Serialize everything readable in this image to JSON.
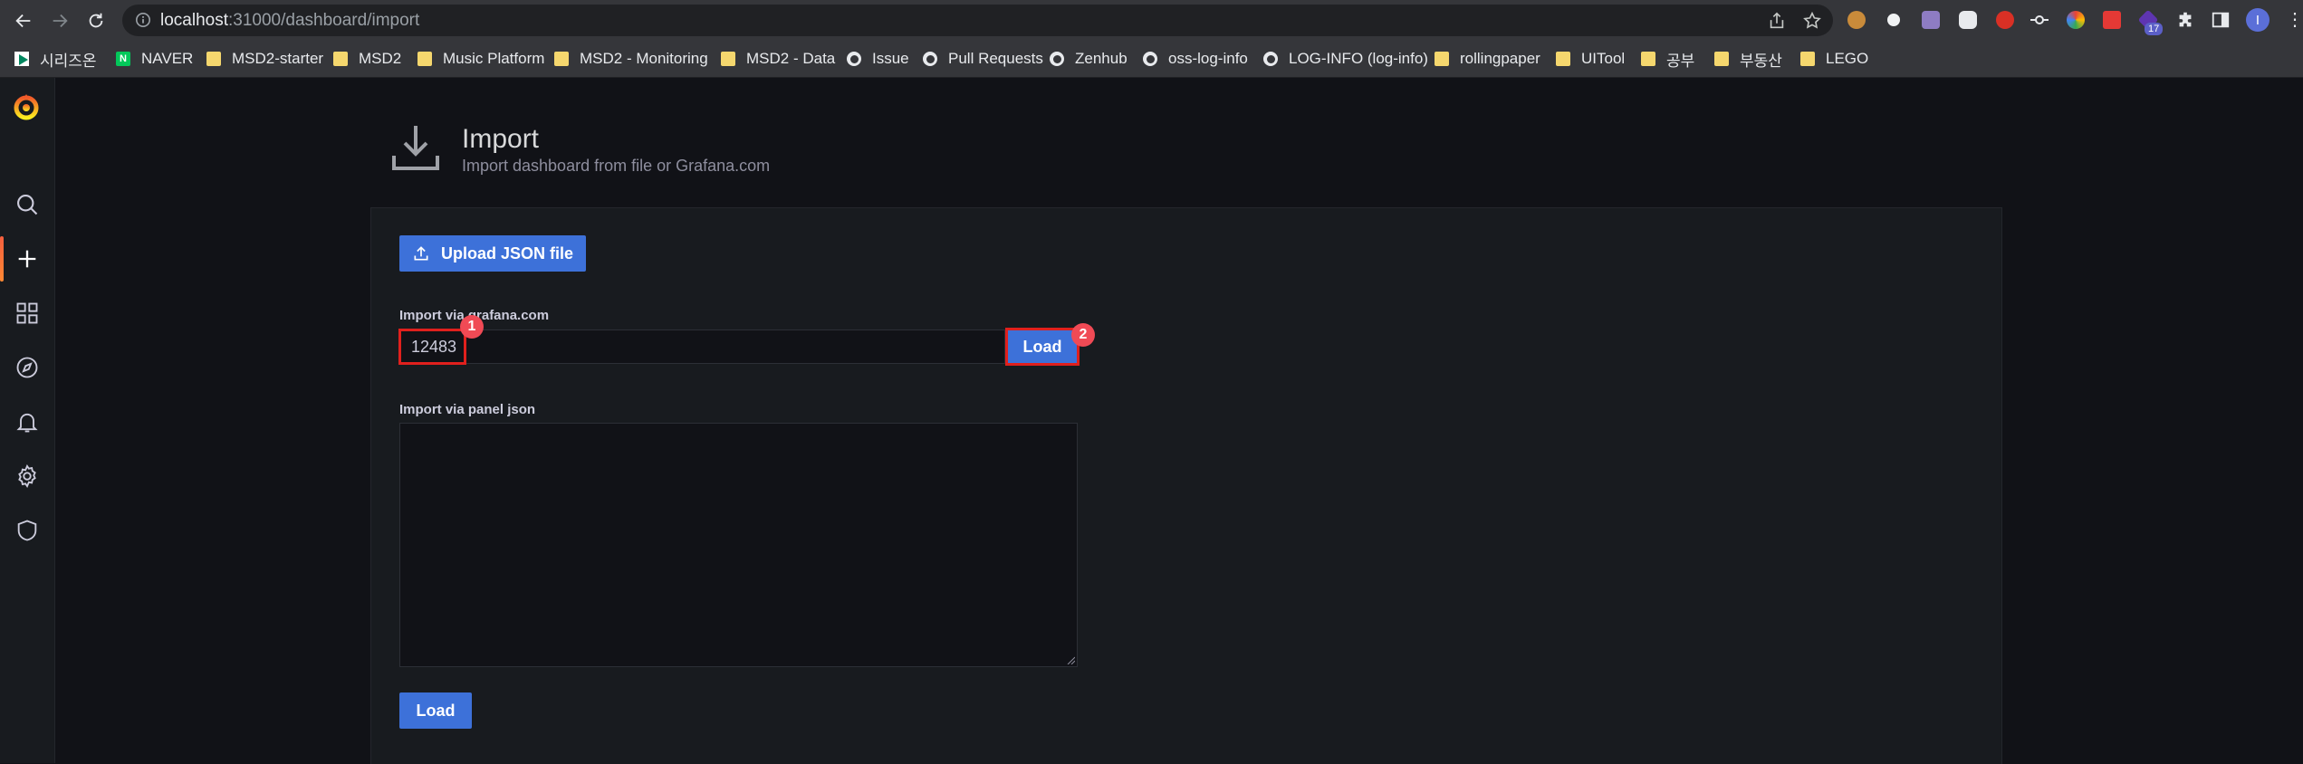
{
  "browser": {
    "url_host": "localhost",
    "url_path": ":31000/dashboard/import",
    "extension_badge": "17",
    "profile_initial": "I"
  },
  "bookmarks": [
    {
      "label": "시리즈온",
      "icon": "play-icon"
    },
    {
      "label": "NAVER",
      "icon": "naver-icon",
      "icon_text": "N"
    },
    {
      "label": "MSD2-starter",
      "icon": "folder-icon"
    },
    {
      "label": "MSD2",
      "icon": "folder-icon"
    },
    {
      "label": "Music Platform",
      "icon": "folder-icon"
    },
    {
      "label": "MSD2 - Monitoring",
      "icon": "folder-icon"
    },
    {
      "label": "MSD2 - Data",
      "icon": "folder-icon"
    },
    {
      "label": "Issue",
      "icon": "github-icon"
    },
    {
      "label": "Pull Requests",
      "icon": "github-icon"
    },
    {
      "label": "Zenhub",
      "icon": "github-icon"
    },
    {
      "label": "oss-log-info",
      "icon": "github-icon"
    },
    {
      "label": "LOG-INFO (log-info)",
      "icon": "github-icon"
    },
    {
      "label": "rollingpaper",
      "icon": "folder-icon"
    },
    {
      "label": "UITool",
      "icon": "folder-icon"
    },
    {
      "label": "공부",
      "icon": "folder-icon"
    },
    {
      "label": "부동산",
      "icon": "folder-icon"
    },
    {
      "label": "LEGO",
      "icon": "folder-icon"
    }
  ],
  "sidebar": {
    "items": [
      {
        "name": "search",
        "icon": "search-icon"
      },
      {
        "name": "create",
        "icon": "plus-icon",
        "active": true
      },
      {
        "name": "dashboards",
        "icon": "apps-icon"
      },
      {
        "name": "explore",
        "icon": "compass-icon"
      },
      {
        "name": "alerting",
        "icon": "bell-icon"
      },
      {
        "name": "configuration",
        "icon": "gear-icon"
      },
      {
        "name": "server-admin",
        "icon": "shield-icon"
      }
    ]
  },
  "header": {
    "title": "Import",
    "subtitle": "Import dashboard from file or Grafana.com"
  },
  "import": {
    "upload_label": "Upload JSON file",
    "gcom_label": "Import via grafana.com",
    "gcom_value": "12483",
    "load_label": "Load",
    "panel_json_label": "Import via panel json",
    "panel_json_value": "",
    "load_bottom_label": "Load"
  },
  "annotations": {
    "marker_1": "1",
    "marker_2": "2"
  },
  "colors": {
    "primary_button": "#3d71d9",
    "highlight": "#e0201d",
    "marker": "#f04a55",
    "active_accent": "#f55f3e"
  }
}
